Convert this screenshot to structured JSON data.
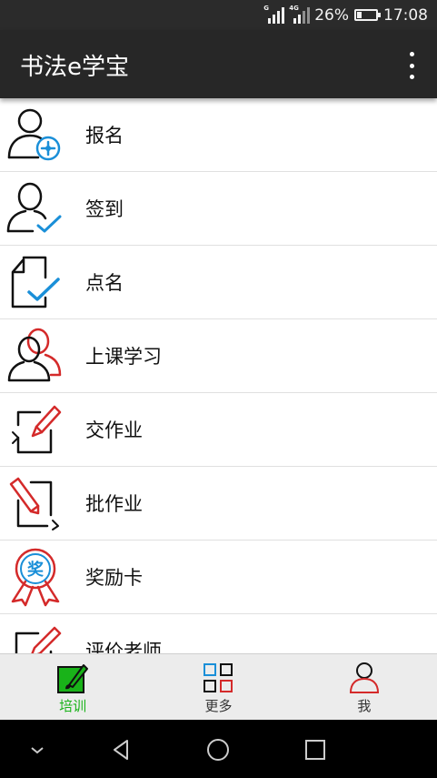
{
  "status_bar": {
    "signal_1_tag": "G",
    "signal_2_tag": "4G",
    "battery_percent": "26%",
    "battery_level": 0.26,
    "time": "17:08"
  },
  "app_bar": {
    "title": "书法e学宝",
    "overflow_icon": "more-vert-icon"
  },
  "menu": {
    "items": [
      {
        "label": "报名",
        "icon": "person-add-icon"
      },
      {
        "label": "签到",
        "icon": "person-check-icon"
      },
      {
        "label": "点名",
        "icon": "document-check-icon"
      },
      {
        "label": "上课学习",
        "icon": "group-class-icon"
      },
      {
        "label": "交作业",
        "icon": "submit-homework-icon"
      },
      {
        "label": "批作业",
        "icon": "grade-homework-icon"
      },
      {
        "label": "奖励卡",
        "icon": "award-ribbon-icon"
      },
      {
        "label": "评价老师",
        "icon": "evaluate-teacher-icon"
      }
    ]
  },
  "award_badge_text": "奖",
  "bottom_nav": {
    "tabs": [
      {
        "label": "培训",
        "icon": "brush-board-icon",
        "active": true
      },
      {
        "label": "更多",
        "icon": "grid-icon",
        "active": false
      },
      {
        "label": "我",
        "icon": "person-icon",
        "active": false
      }
    ]
  },
  "colors": {
    "accent_blue": "#1a8fd8",
    "accent_red": "#d42a2a",
    "active_green": "#19b319",
    "app_bar": "#272727"
  }
}
